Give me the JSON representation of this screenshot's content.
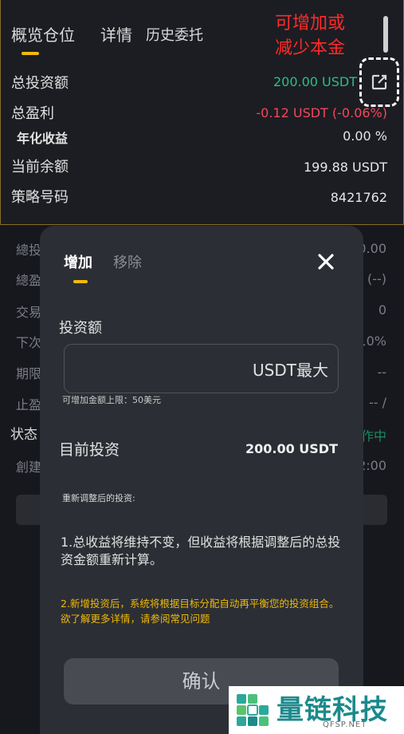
{
  "tabs": [
    {
      "label": "概览仓位"
    },
    {
      "label": "详情"
    },
    {
      "label": "历史委托"
    }
  ],
  "annotation": [
    "可增加或",
    "减少本金"
  ],
  "summary": {
    "total_investment": {
      "label": "总投资额",
      "value": "200.00 USDT"
    },
    "total_profit": {
      "label": "总盈利",
      "value": "-0.12 USDT (-0.06%)"
    },
    "annual_return": {
      "label": "年化收益",
      "value": "0.00 %"
    },
    "current_balance": {
      "label": "当前余额",
      "value": "199.88 USDT"
    },
    "strategy_id": {
      "label": "策略号码",
      "value": "8421762"
    }
  },
  "background_rows": [
    {
      "label": "總投",
      "value": "0.00"
    },
    {
      "label": "總盈",
      "value": "(--)"
    },
    {
      "label": "交易",
      "value": "0"
    },
    {
      "label": "下次",
      "value": "10%"
    },
    {
      "label": "期限",
      "value": "--"
    },
    {
      "label": "止盈",
      "value": "/ --"
    },
    {
      "label": "状态",
      "value": "作中"
    },
    {
      "label": "創建",
      "value": "2:00"
    }
  ],
  "modal": {
    "tabs": {
      "add": "增加",
      "remove": "移除"
    },
    "amount_label": "投资额",
    "amount_placeholder": "",
    "input_suffix": "USDT最大",
    "limit_note": "可增加金额上限：50美元",
    "current_label": "目前投资",
    "current_value": "200.00 USDT",
    "adjusted_label": "重新调整后的投资:",
    "note_1": "1.总收益将维持不变，但收益将根据调整后的总投资金额重新计算。",
    "note_2": "2.新增投资后，系统将根据目标分配自动再平衡您的投资组合。欲了解更多详情，请参阅常见问题",
    "confirm_label": "确认"
  },
  "watermark": {
    "title": "量链科技",
    "subtitle": "QFSP.NET"
  },
  "colors": {
    "accent": "#f0b90b",
    "positive": "#2ebd85",
    "negative": "#f6465d",
    "annotation": "#ff2a2a"
  },
  "icons": {
    "edit": "edit-icon",
    "close": "close-icon"
  }
}
